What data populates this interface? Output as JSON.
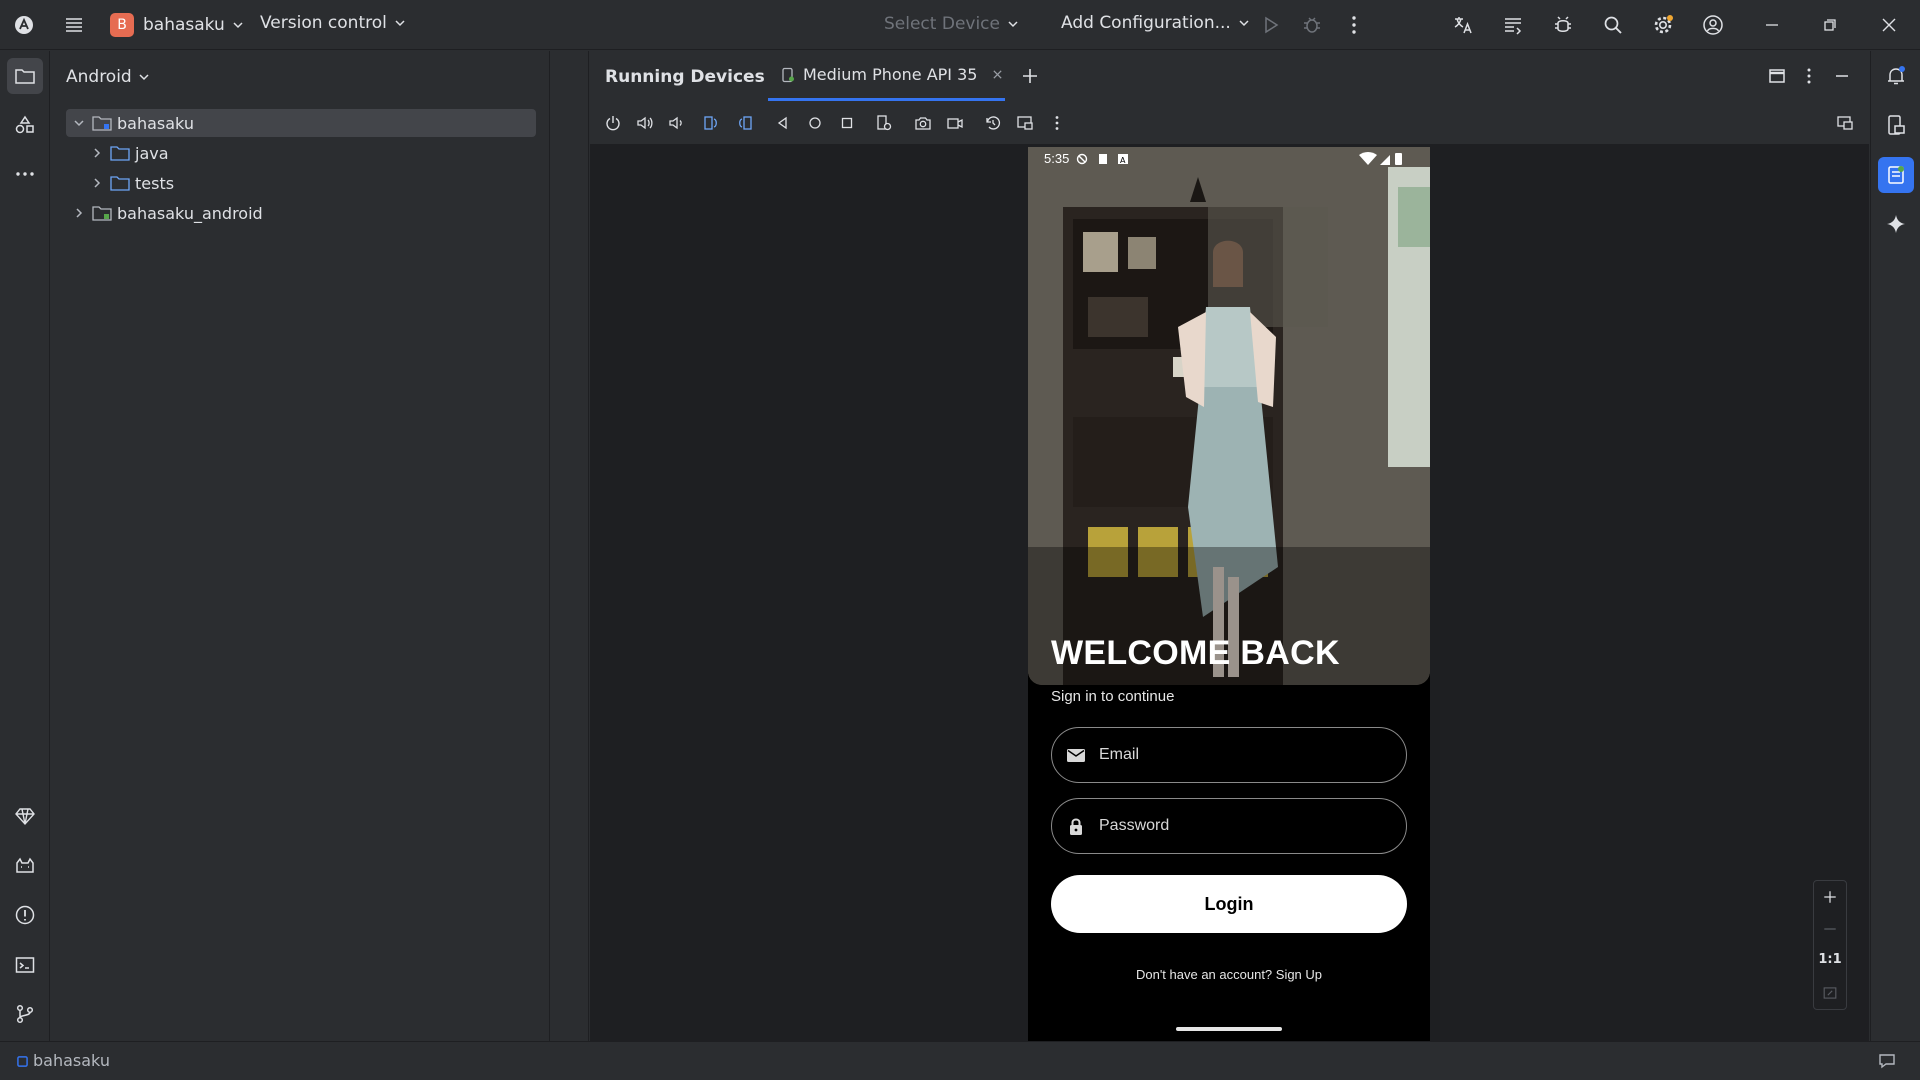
{
  "titlebar": {
    "project_initial": "B",
    "project_name": "bahasaku",
    "version_control": "Version control",
    "device_select": "Select Device",
    "add_config": "Add Configuration...",
    "brand_color": "#e66c52"
  },
  "project_panel": {
    "view_mode": "Android",
    "tree": [
      {
        "label": "bahasaku",
        "selected": true,
        "expanded": true
      },
      {
        "label": "java",
        "selected": false,
        "expanded": false
      },
      {
        "label": "tests",
        "selected": false,
        "expanded": false
      },
      {
        "label": "bahasaku_android",
        "selected": false,
        "expanded": false
      }
    ]
  },
  "running_devices": {
    "title": "Running Devices",
    "tab_label": "Medium Phone API 35",
    "accent": "#3574f0"
  },
  "phone": {
    "status_time": "5:35",
    "welcome_title": "WELCOME BACK",
    "subtitle": "Sign in to continue",
    "email_placeholder": "Email",
    "password_placeholder": "Password",
    "login_label": "Login",
    "signup_prompt": "Don't have an account? Sign Up"
  },
  "zoom": {
    "ratio_label": "1:1"
  },
  "status_bar": {
    "project": "bahasaku"
  }
}
